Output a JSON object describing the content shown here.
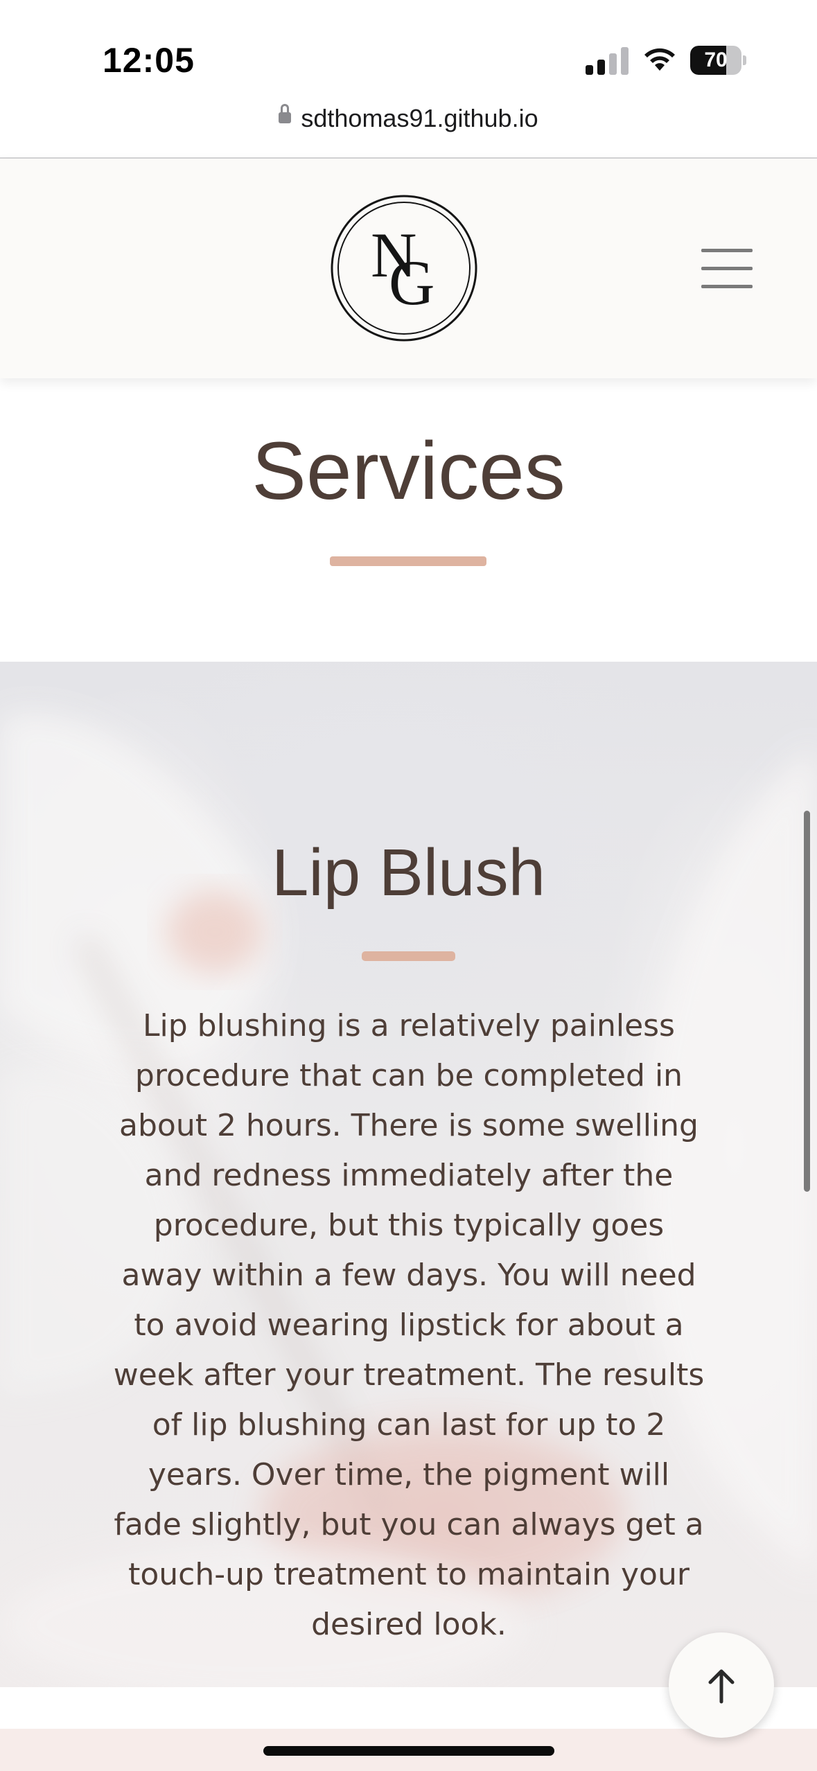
{
  "status_bar": {
    "time": "12:05",
    "battery": "70",
    "battery_level": 0.7
  },
  "browser": {
    "url": "sdthomas91.github.io"
  },
  "header": {
    "logo_text": "NG",
    "menu_icon": "hamburger-icon"
  },
  "services": {
    "title": "Services",
    "accent_color": "#deb3a0"
  },
  "lip_blush": {
    "title": "Lip Blush",
    "description": "Lip blushing is a relatively painless procedure that can be completed in about 2 hours. There is some swelling and redness immediately after the procedure, but this typically goes away within a few days. You will need to avoid wearing lipstick for about a week after your treatment. The results of lip blushing can last for up to 2 years. Over time, the pigment will fade slightly, but you can always get a touch-up treatment to maintain your desired look."
  },
  "back_to_top": {
    "icon": "arrow-up-icon"
  }
}
